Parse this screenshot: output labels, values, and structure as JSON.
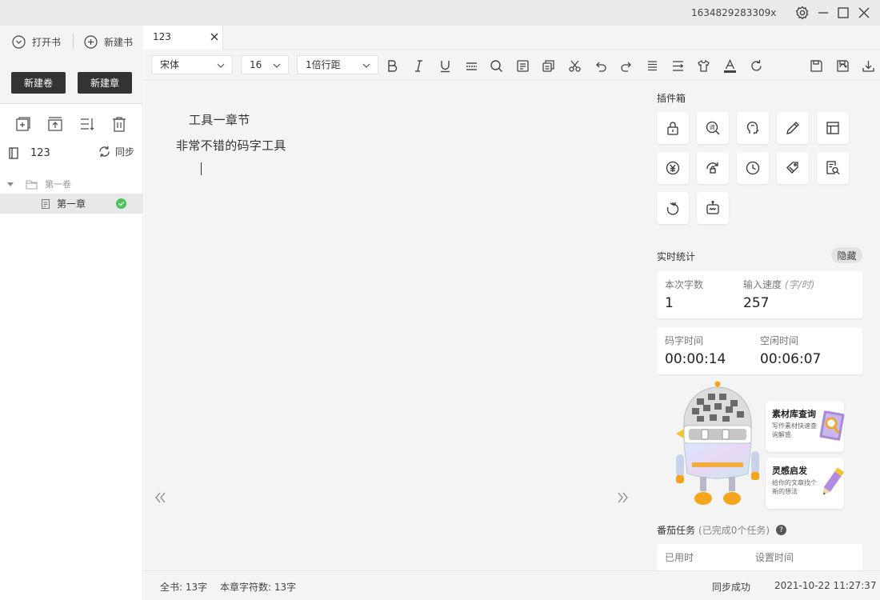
{
  "titlebar": {
    "account": "1634829283309x",
    "icons": [
      "gear-icon",
      "minimize-icon",
      "maximize-icon",
      "close-icon"
    ]
  },
  "sidebar": {
    "open_book": "打开书",
    "new_book": "新建书",
    "new_volume": "新建卷",
    "new_chapter": "新建章",
    "tools": [
      "add-chapter-icon",
      "import-icon",
      "sort-icon",
      "trash-icon"
    ],
    "book_name": "123",
    "sync_label": "同步",
    "tree": {
      "volume": "第一卷",
      "chapter": "第一章",
      "chapter_status_color": "#4cc35a"
    }
  },
  "tabs": [
    {
      "label": "123"
    }
  ],
  "toolbar": {
    "font": "宋体",
    "size": "16",
    "line_spacing": "1倍行距",
    "tools": [
      "bold-icon",
      "italic-icon",
      "underline-icon",
      "strikethrough-icon",
      "search-icon",
      "format-icon",
      "copy-icon",
      "cut-icon",
      "undo-icon",
      "redo-icon",
      "align-icon",
      "indent-icon",
      "theme-icon",
      "font-color-icon",
      "refresh-icon",
      "save-icon",
      "save-as-icon",
      "download-icon"
    ]
  },
  "editor": {
    "line1": "工具一章节",
    "line2": "非常不错的码字工具"
  },
  "panel": {
    "plugins_title": "插件箱",
    "plugins": [
      "lock-icon",
      "word-search-icon",
      "brain-icon",
      "pencil-icon",
      "table-icon",
      "yuan-icon",
      "lock-refresh-icon",
      "clock-icon",
      "tag-icon",
      "doc-search-icon",
      "tomato-icon",
      "robot-icon"
    ],
    "stats_title": "实时统计",
    "hide_label": "隐藏",
    "session_words_label": "本次字数",
    "session_words": "1",
    "speed_label": "输入速度",
    "speed_unit": "(字/时)",
    "speed": "257",
    "typing_time_label": "码字时间",
    "typing_time": "00:00:14",
    "idle_time_label": "空闲时间",
    "idle_time": "00:06:07",
    "promo1_title": "素材库查询",
    "promo1_desc": "写作素材快速查询解惑",
    "promo2_title": "灵感启发",
    "promo2_desc": "给你的文章找个新的想法",
    "tomato_title": "番茄任务",
    "tomato_sub": "(已完成0个任务)",
    "used_time_label": "已用时",
    "set_time_label": "设置时间"
  },
  "status": {
    "book_total": "全书: 13字",
    "chapter_total": "本章字符数: 13字",
    "sync_status": "同步成功",
    "timestamp": "2021-10-22 11:27:37"
  }
}
